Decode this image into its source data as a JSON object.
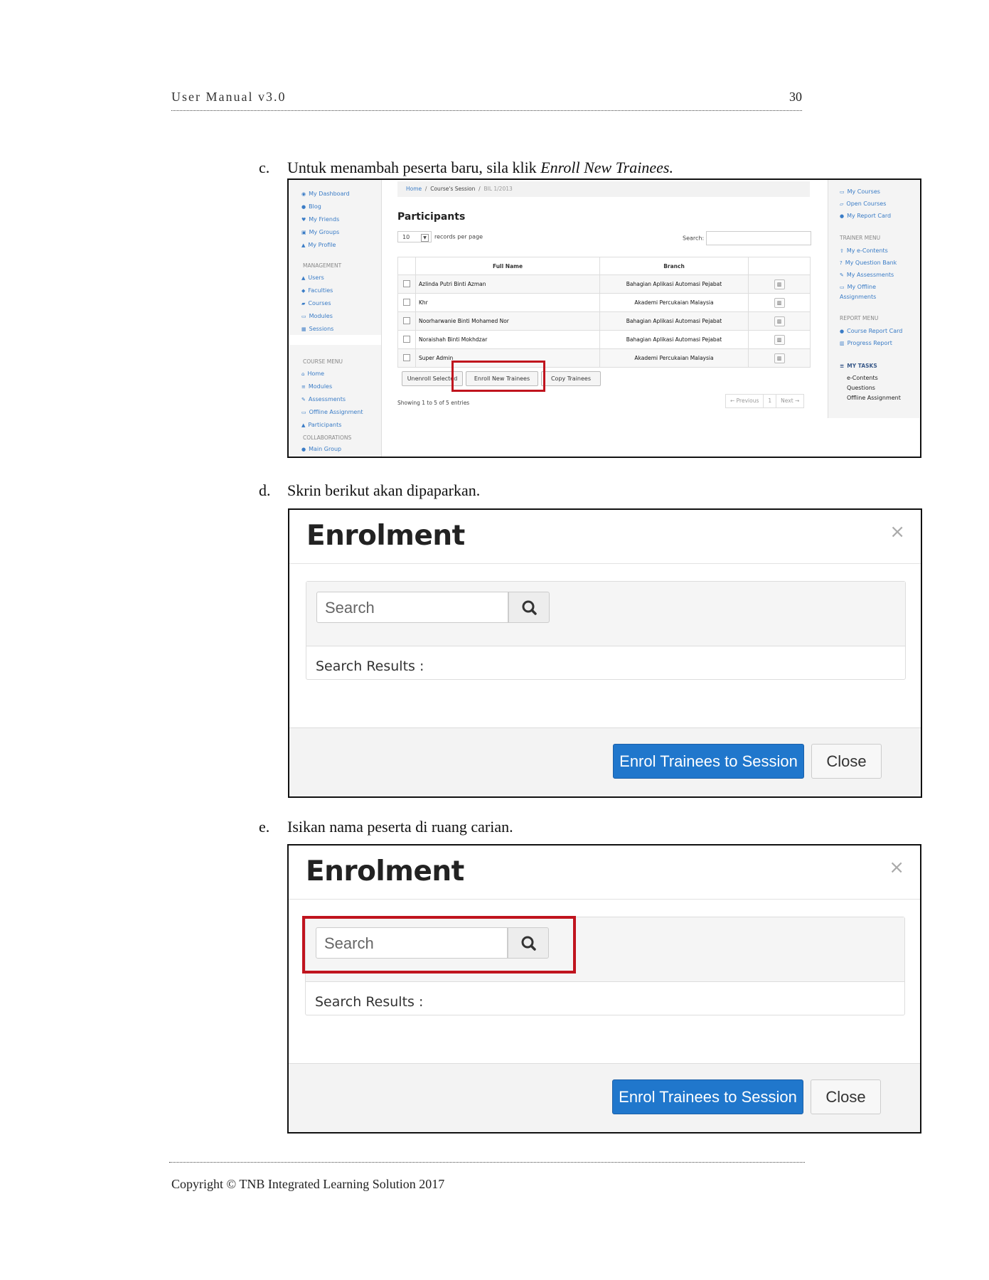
{
  "header": {
    "title": "User Manual v3.0",
    "page_number": "30"
  },
  "steps": [
    {
      "marker": "c.",
      "text": "Untuk menambah peserta baru, sila klik ",
      "emphasis": "Enroll New Trainees."
    },
    {
      "marker": "d.",
      "text": "Skrin berikut akan dipaparkan."
    },
    {
      "marker": "e.",
      "text": "Isikan nama peserta di ruang carian."
    }
  ],
  "participants_screen": {
    "left_nav": {
      "top_items": [
        {
          "label": "My Dashboard",
          "icon": "dashboard-icon"
        },
        {
          "label": "Blog",
          "icon": "globe-icon"
        },
        {
          "label": "My Friends",
          "icon": "heart-icon"
        },
        {
          "label": "My Groups",
          "icon": "group-icon"
        },
        {
          "label": "My Profile",
          "icon": "user-icon"
        }
      ],
      "management_title": "MANAGEMENT",
      "management_items": [
        {
          "label": "Users",
          "icon": "user-icon"
        },
        {
          "label": "Faculties",
          "icon": "faculty-icon"
        },
        {
          "label": "Courses",
          "icon": "book-icon"
        },
        {
          "label": "Modules",
          "icon": "module-icon"
        },
        {
          "label": "Sessions",
          "icon": "calendar-icon"
        }
      ],
      "course_menu_title": "COURSE MENU",
      "course_items": [
        {
          "label": "Home",
          "icon": "home-icon"
        },
        {
          "label": "Modules",
          "icon": "list-icon"
        },
        {
          "label": "Assessments",
          "icon": "edit-icon"
        },
        {
          "label": "Offline Assignment",
          "icon": "document-icon"
        },
        {
          "label": "Participants",
          "icon": "user-icon"
        }
      ],
      "collaborations_title": "COLLABORATIONS",
      "collaboration_items": [
        {
          "label": "Main Group",
          "icon": "comment-icon"
        }
      ]
    },
    "breadcrumb": {
      "home": "Home",
      "course_session": "Course's Session",
      "current": "BIL 1/2013"
    },
    "title": "Participants",
    "records_per_page": {
      "value": "10",
      "label": "records per page"
    },
    "search_label": "Search:",
    "table": {
      "headers": [
        "Full Name",
        "Branch"
      ],
      "rows": [
        {
          "name": "Azlinda Putri Binti Azman",
          "branch": "Bahagian Aplikasi Automasi Pejabat"
        },
        {
          "name": "Khr",
          "branch": "Akademi Percukaian Malaysia"
        },
        {
          "name": "Noorharwanie Binti Mohamed Nor",
          "branch": "Bahagian Aplikasi Automasi Pejabat"
        },
        {
          "name": "Noraishah Binti Mokhdzar",
          "branch": "Bahagian Aplikasi Automasi Pejabat"
        },
        {
          "name": "Super Admin",
          "branch": "Akademi Percukaian Malaysia"
        }
      ]
    },
    "buttons": {
      "unenroll": "Unenroll Selected",
      "enroll": "Enroll New Trainees",
      "copy": "Copy Trainees"
    },
    "showing": "Showing 1 to 5 of 5 entries",
    "pagination": {
      "prev": "← Previous",
      "page": "1",
      "next": "Next →"
    },
    "right_nav": {
      "top_items": [
        {
          "label": "My Courses",
          "icon": "folder-icon"
        },
        {
          "label": "Open Courses",
          "icon": "folder-open-icon"
        },
        {
          "label": "My Report Card",
          "icon": "circle-icon"
        }
      ],
      "trainer_title": "TRAINER MENU",
      "trainer_items": [
        {
          "label": "My e-Contents",
          "icon": "upload-icon"
        },
        {
          "label": "My Question Bank",
          "icon": "question-icon"
        },
        {
          "label": "My Assessments",
          "icon": "edit-icon"
        },
        {
          "label": "My Offline Assignments",
          "icon": "document-icon"
        }
      ],
      "report_title": "REPORT MENU",
      "report_items": [
        {
          "label": "Course Report Card",
          "icon": "circle-icon"
        },
        {
          "label": "Progress Report",
          "icon": "bar-chart-icon"
        }
      ],
      "tasks_title": "MY TASKS",
      "tasks": [
        "e-Contents",
        "Questions",
        "Offline Assignment"
      ]
    }
  },
  "enrolment_modal": {
    "title": "Enrolment",
    "close_glyph": "×",
    "search_placeholder": "Search",
    "results_label": "Search Results :",
    "enrol_button": "Enrol Trainees to Session",
    "close_button": "Close"
  },
  "colors": {
    "highlight": "#c0141e",
    "primary": "#2077cc",
    "link": "#3a7cc6"
  },
  "footer": {
    "copyright": "Copyright © TNB Integrated Learning Solution 2017"
  }
}
